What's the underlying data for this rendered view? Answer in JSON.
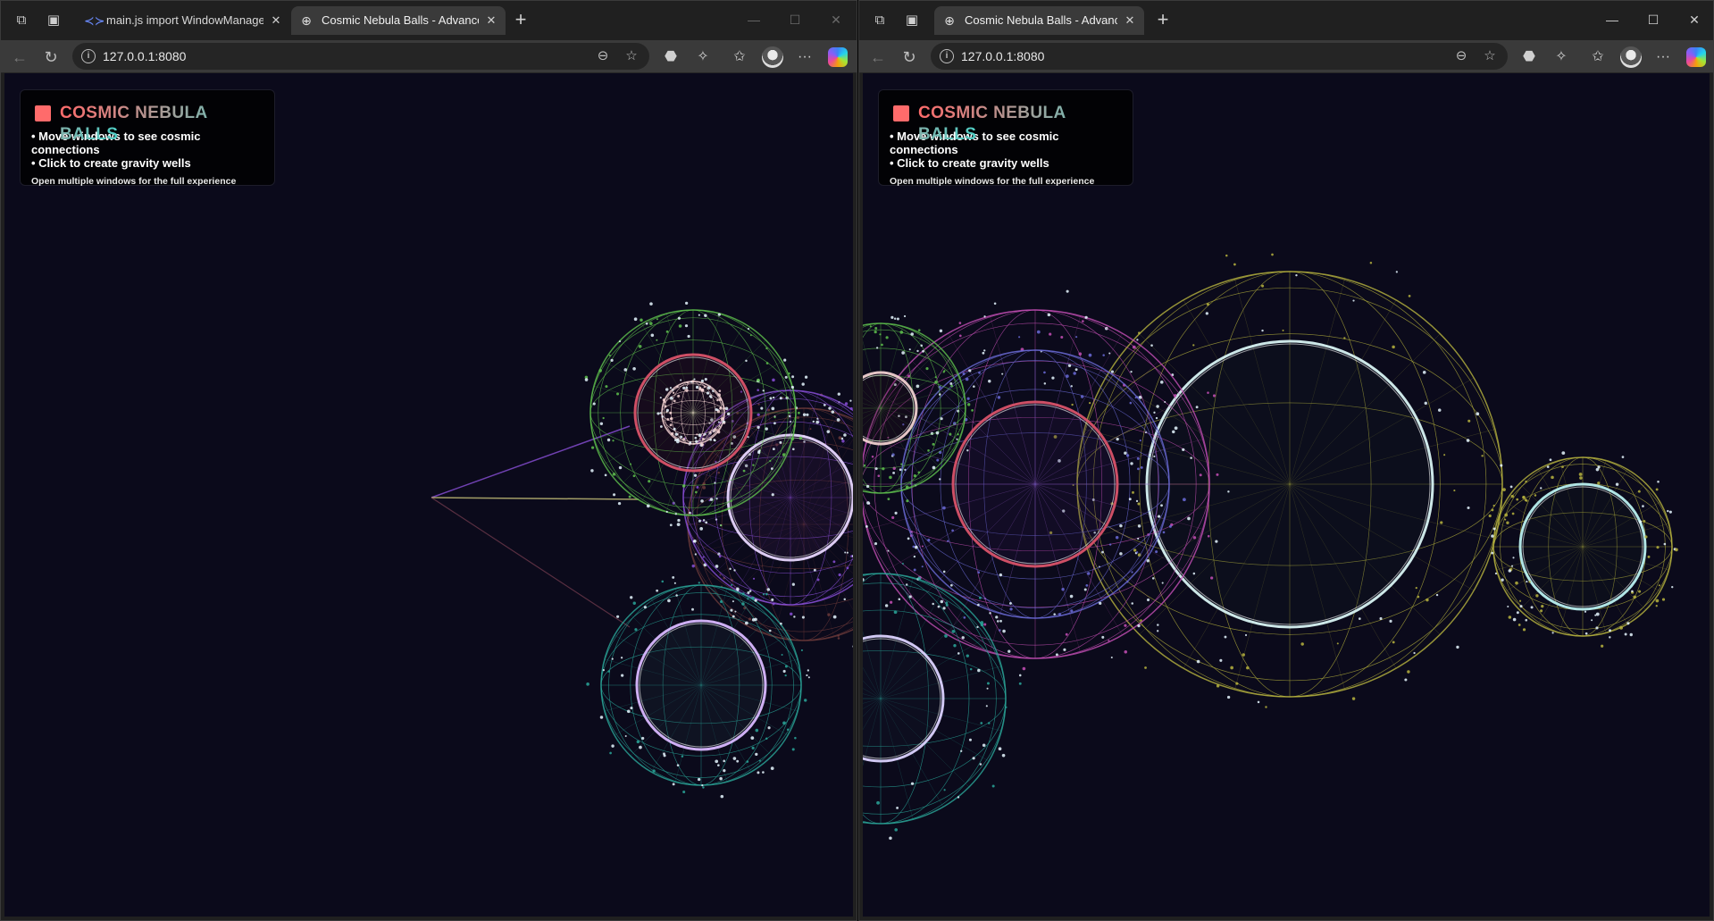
{
  "windows": [
    {
      "tabs": [
        {
          "title": "main.js import WindowManager f",
          "favicon": "code-editor-icon",
          "active": false
        },
        {
          "title": "Cosmic Nebula Balls - Advanced I",
          "favicon": "globe-icon",
          "active": true
        }
      ],
      "url": "127.0.0.1:8080",
      "window_controls": {
        "minimize": "—",
        "maximize": "☐",
        "close": "✕"
      },
      "panel": {
        "title": "COSMIC NEBULA BALLS",
        "line1": "• Move windows to see cosmic connections",
        "line2": "• Click to create gravity wells",
        "note": "Open multiple windows for the full experience"
      }
    },
    {
      "tabs": [
        {
          "title": "Cosmic Nebula Balls - Advanced I",
          "favicon": "globe-icon",
          "active": true
        }
      ],
      "url": "127.0.0.1:8080",
      "window_controls": {
        "minimize": "—",
        "maximize": "☐",
        "close": "✕"
      },
      "panel": {
        "title": "COSMIC NEBULA BALLS",
        "line1": "• Move windows to see cosmic connections",
        "line2": "• Click to create gravity wells",
        "note": "Open multiple windows for the full experience"
      }
    }
  ],
  "icons": {
    "workspaces": "⧉",
    "tab_actions": "▣",
    "new_tab": "+",
    "back": "←",
    "refresh": "↻",
    "zoom": "⊖",
    "favorite": "☆",
    "extensions": "⬣",
    "puzzle": "✧",
    "favorites_bar": "✩",
    "more": "···"
  },
  "colors": {
    "brand_square": "#ff6b6b",
    "title_gradient_start": "#ff6b6b",
    "title_gradient_end": "#4ecdc4",
    "canvas_background": "#0b0a1b",
    "chrome_background": "#202020",
    "toolbar_background": "#3a3a3a",
    "orb_green": "#5fc24d",
    "orb_red": "#d9536a",
    "orb_purple": "#8a4fd8",
    "orb_teal": "#2aa79a",
    "orb_olive": "#b8b43e",
    "orb_magenta": "#c54fb6"
  }
}
